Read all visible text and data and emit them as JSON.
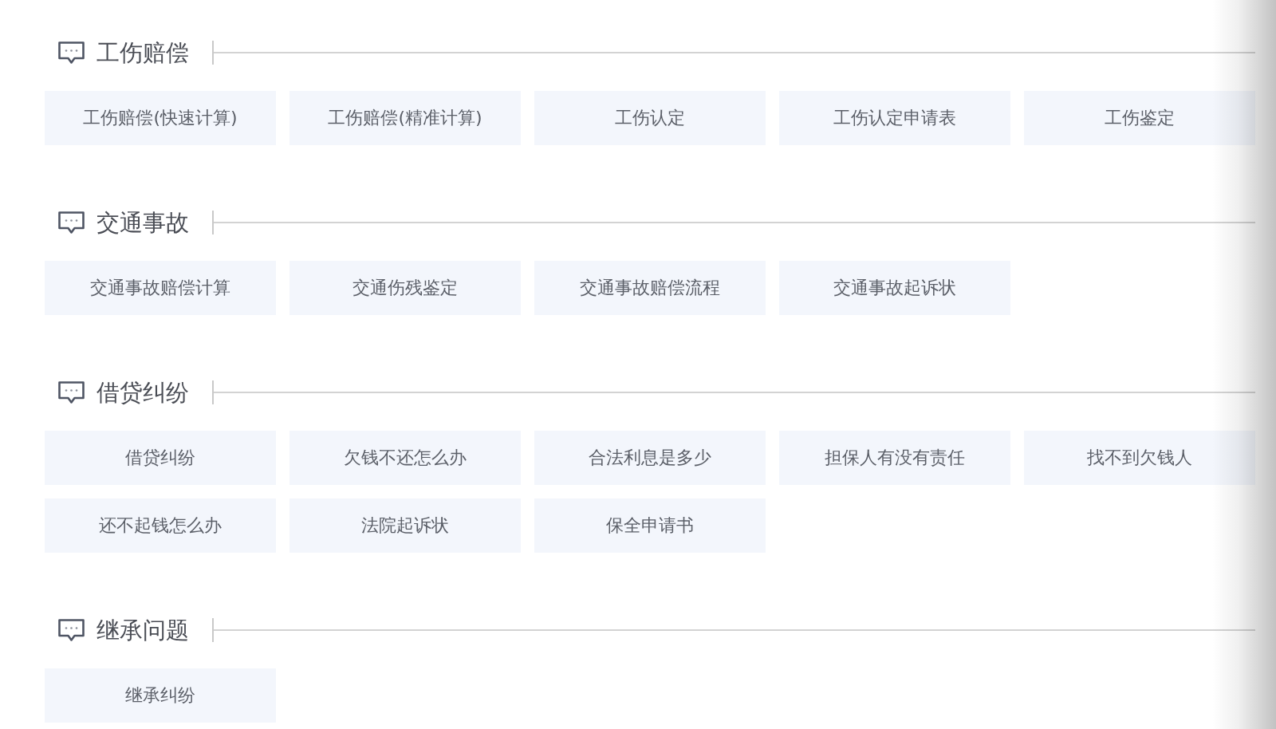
{
  "sections": [
    {
      "title": "工伤赔偿",
      "items": [
        "工伤赔偿(快速计算)",
        "工伤赔偿(精准计算)",
        "工伤认定",
        "工伤认定申请表",
        "工伤鉴定"
      ]
    },
    {
      "title": "交通事故",
      "items": [
        "交通事故赔偿计算",
        "交通伤残鉴定",
        "交通事故赔偿流程",
        "交通事故起诉状"
      ]
    },
    {
      "title": "借贷纠纷",
      "items": [
        "借贷纠纷",
        "欠钱不还怎么办",
        "合法利息是多少",
        "担保人有没有责任",
        "找不到欠钱人",
        "还不起钱怎么办",
        "法院起诉状",
        "保全申请书"
      ]
    },
    {
      "title": "继承问题",
      "items": [
        "继承纠纷"
      ]
    }
  ]
}
